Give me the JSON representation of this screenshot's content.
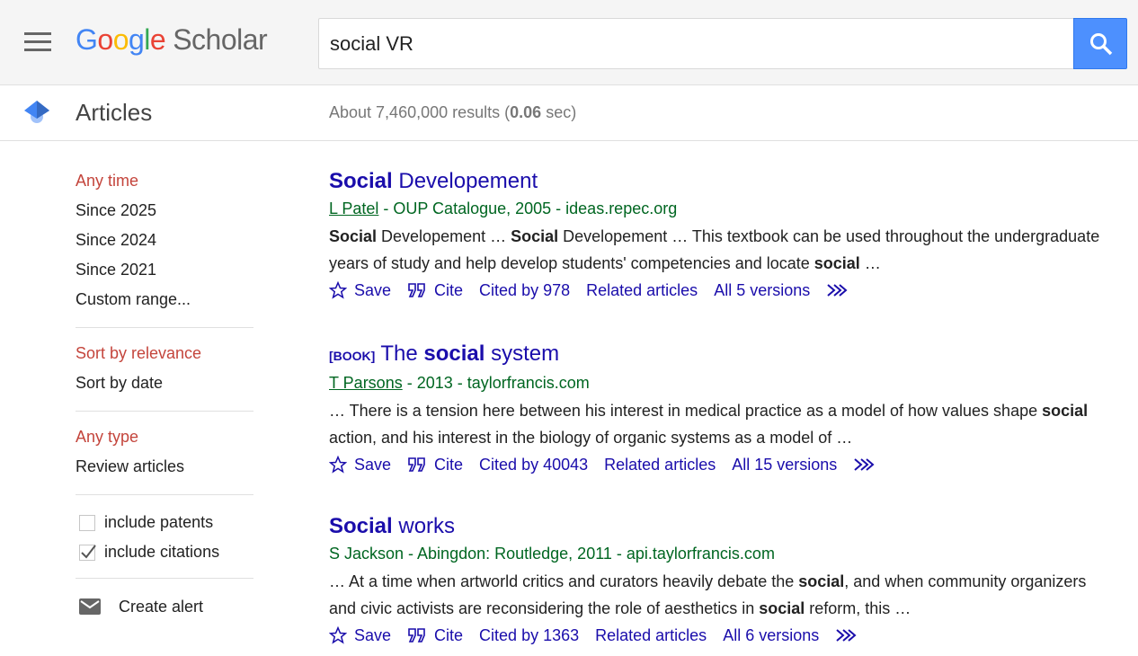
{
  "header": {
    "logo_google": "Google",
    "logo_scholar": "Scholar",
    "search_value": "social VR"
  },
  "subheader": {
    "section": "Articles",
    "stats_prefix": "About 7,460,000 results (",
    "stats_time": "0.06",
    "stats_suffix": " sec)"
  },
  "sidebar": {
    "time": [
      "Any time",
      "Since 2025",
      "Since 2024",
      "Since 2021",
      "Custom range..."
    ],
    "sort": [
      "Sort by relevance",
      "Sort by date"
    ],
    "type": [
      "Any type",
      "Review articles"
    ],
    "include_patents": "include patents",
    "include_patents_checked": false,
    "include_citations": "include citations",
    "include_citations_checked": true,
    "create_alert": "Create alert"
  },
  "colors": {
    "link": "#1a0dab",
    "green": "#006621",
    "selected": "#c4453c",
    "button": "#4d90fe"
  },
  "results": [
    {
      "tag": "",
      "title": [
        {
          "t": "Social",
          "b": true
        },
        {
          "t": " Developement",
          "b": false
        }
      ],
      "author": "L Patel",
      "meta": " - OUP Catalogue, 2005 - ideas.repec.org",
      "snippet": [
        {
          "t": "Social",
          "b": true
        },
        {
          "t": " Developement … ",
          "b": false
        },
        {
          "t": "Social",
          "b": true
        },
        {
          "t": " Developement … This textbook can be used throughout the undergraduate years of study and help develop students' competencies and locate ",
          "b": false
        },
        {
          "t": "social",
          "b": true
        },
        {
          "t": " …",
          "b": false
        }
      ],
      "save": "Save",
      "cite": "Cite",
      "cited_by": "Cited by 978",
      "related": "Related articles",
      "versions": "All 5 versions"
    },
    {
      "tag": "[BOOK]",
      "title": [
        {
          "t": "The ",
          "b": false
        },
        {
          "t": "social",
          "b": true
        },
        {
          "t": " system",
          "b": false
        }
      ],
      "author": "T Parsons",
      "meta": " - 2013 - taylorfrancis.com",
      "snippet": [
        {
          "t": "… There is a tension here between his interest in medical practice as a model of how values shape ",
          "b": false
        },
        {
          "t": "social",
          "b": true
        },
        {
          "t": " action, and his interest in the biology of organic systems as a model of …",
          "b": false
        }
      ],
      "save": "Save",
      "cite": "Cite",
      "cited_by": "Cited by 40043",
      "related": "Related articles",
      "versions": "All 15 versions"
    },
    {
      "tag": "",
      "title": [
        {
          "t": "Social",
          "b": true
        },
        {
          "t": " works",
          "b": false
        }
      ],
      "author": "",
      "meta": "S Jackson - Abingdon: Routledge, 2011 - api.taylorfrancis.com",
      "snippet": [
        {
          "t": "… At a time when artworld critics and curators heavily debate the ",
          "b": false
        },
        {
          "t": "social",
          "b": true
        },
        {
          "t": ", and when community organizers and civic activists are reconsidering the role of aesthetics in ",
          "b": false
        },
        {
          "t": "social",
          "b": true
        },
        {
          "t": " reform, this …",
          "b": false
        }
      ],
      "save": "Save",
      "cite": "Cite",
      "cited_by": "Cited by 1363",
      "related": "Related articles",
      "versions": "All 6 versions"
    }
  ]
}
